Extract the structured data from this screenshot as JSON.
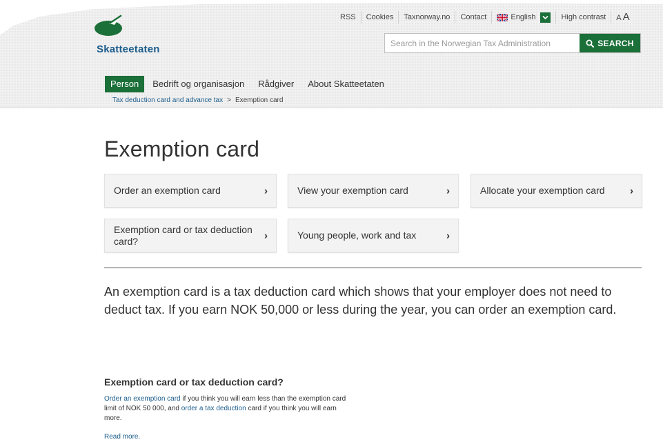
{
  "brand": {
    "name": "Skatteetaten",
    "accent": "#1b6f38",
    "link": "#1c5d8c"
  },
  "toplinks": {
    "rss": "RSS",
    "cookies": "Cookies",
    "taxnorway": "Taxnorway.no",
    "contact": "Contact",
    "language": "English",
    "high_contrast": "High contrast",
    "aa_small": "A",
    "aa_big": "A"
  },
  "search": {
    "placeholder": "Search in the Norwegian Tax Administration",
    "button": "SEARCH"
  },
  "nav": {
    "items": [
      {
        "label": "Person"
      },
      {
        "label": "Bedrift og organisasjon"
      },
      {
        "label": "Rådgiver"
      },
      {
        "label": "About Skatteetaten"
      }
    ]
  },
  "breadcrumb": {
    "parent": "Tax deduction card and advance tax",
    "separator": ">",
    "current": "Exemption card"
  },
  "page": {
    "title": "Exemption card"
  },
  "cards": [
    {
      "label": "Order an exemption card"
    },
    {
      "label": "View your exemption card"
    },
    {
      "label": "Allocate your exemption card"
    },
    {
      "label": "Exemption card or tax deduction card?"
    },
    {
      "label": "Young people, work and tax"
    }
  ],
  "intro": "An exemption card is a tax deduction card which shows that your employer does not need to deduct tax. If you earn NOK 50,000 or less during the year, you can order an exemption card.",
  "section": {
    "heading": "Exemption card or tax deduction card?",
    "link1": "Order an exemption card",
    "text1": " if you think you will earn less than the exemption card limit of NOK 50 000, and ",
    "link2": "order a tax deduction",
    "text2": " card if you think you will earn more.",
    "read_more": "Read more."
  }
}
